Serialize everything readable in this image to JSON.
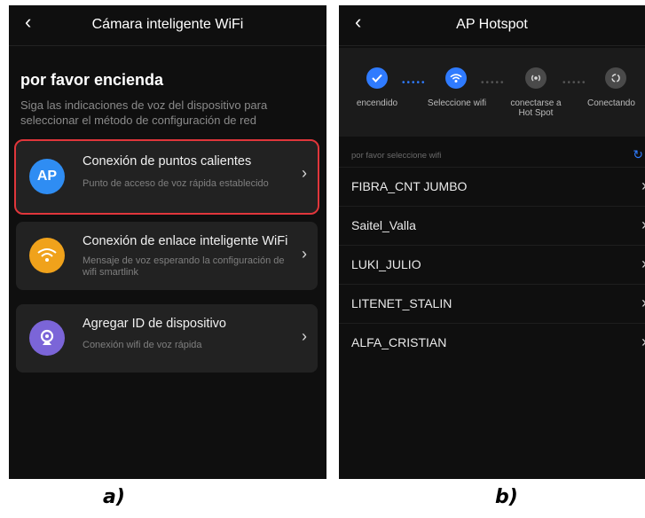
{
  "panel_a": {
    "title": "Cámara inteligente WiFi",
    "back_icon": "chevron-left-icon",
    "heading": "por favor encienda",
    "subtext": "Siga las indicaciones de voz del dispositivo para seleccionar el método de configuración de red",
    "options": [
      {
        "icon_text": "AP",
        "icon_color": "#2f8df3",
        "title": "Conexión de puntos calientes",
        "desc": "Punto de acceso de voz rápida establecido",
        "selected": true
      },
      {
        "icon_name": "wifi-icon",
        "icon_color": "#f0a21b",
        "title": "Conexión de enlace inteligente WiFi",
        "desc": "Mensaje de voz esperando la configuración de wifi smartlink",
        "selected": false
      },
      {
        "icon_name": "camera-icon",
        "icon_color": "#7b65d8",
        "title": "Agregar ID de dispositivo",
        "desc": "Conexión wifi de voz rápida",
        "selected": false
      }
    ]
  },
  "panel_b": {
    "title": "AP Hotspot",
    "steps": [
      {
        "label": "encendido",
        "icon": "check-icon",
        "active": true
      },
      {
        "label": "Seleccione wifi",
        "icon": "wifi-icon",
        "active": true
      },
      {
        "label": "conectarse a Hot Spot",
        "icon": "hotspot-icon",
        "active": false
      },
      {
        "label": "Conectando",
        "icon": "sync-icon",
        "active": false
      }
    ],
    "list_hint": "por favor seleccione wifi",
    "networks": [
      "FIBRA_CNT JUMBO",
      "Saitel_Valla",
      "LUKI_JULIO",
      "LITENET_STALIN",
      "ALFA_CRISTIAN"
    ]
  },
  "captions": {
    "a": "a)",
    "b": "b)"
  },
  "colors": {
    "accent_blue": "#2f7bff",
    "selected_border": "#e0363b",
    "background": "#0f0f0f",
    "card": "#222222"
  }
}
